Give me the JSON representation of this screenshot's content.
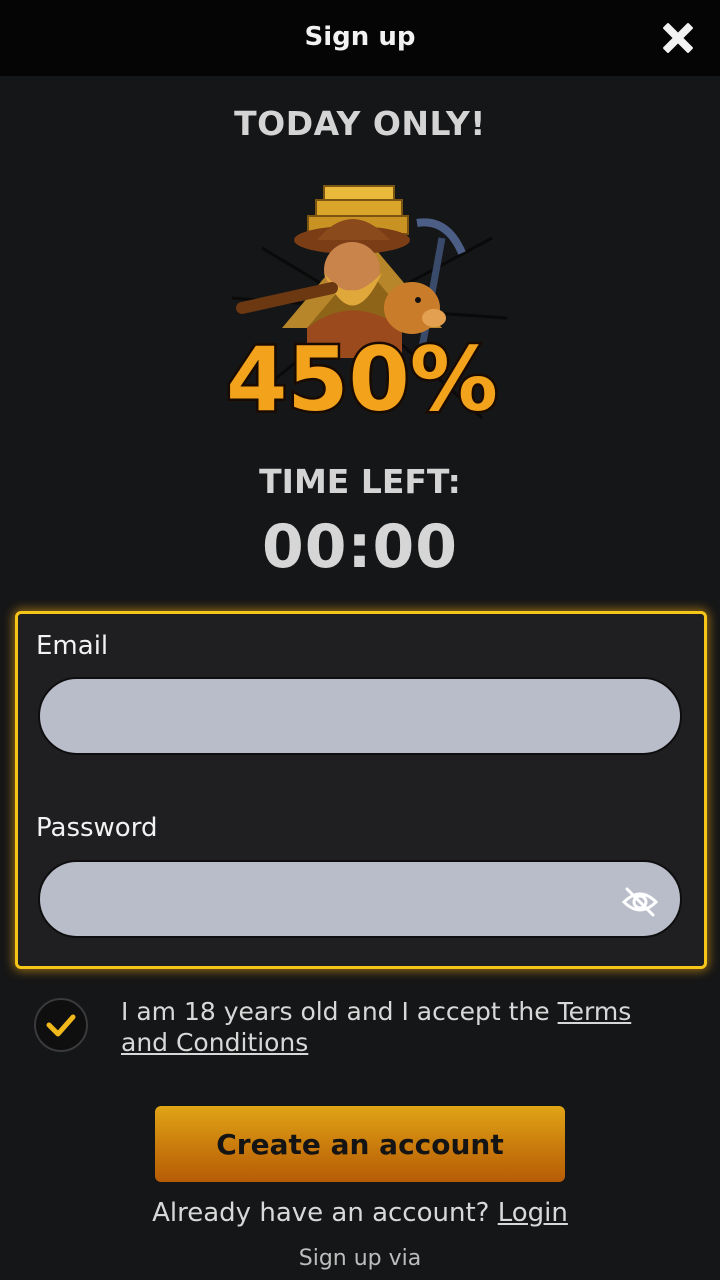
{
  "header": {
    "title": "Sign up",
    "close_icon": "close-icon"
  },
  "promo": {
    "heading": "TODAY ONLY!",
    "bonus_text": "450%",
    "timer_label": "TIME LEFT:",
    "timer_value": "00:00"
  },
  "form": {
    "email_label": "Email",
    "email_value": "",
    "password_label": "Password",
    "password_value": "",
    "password_toggle_icon": "eye-off-icon"
  },
  "consent": {
    "checked": true,
    "text": "I am 18 years old and I accept the ",
    "terms_link": "Terms and Conditions"
  },
  "actions": {
    "create_account_label": "Create an account",
    "already_text": "Already have an account?",
    "login_link": "Login",
    "signup_via": "Sign up via"
  },
  "colors": {
    "accent": "#f5c518",
    "button_top": "#e0a516",
    "button_bottom": "#b65c06",
    "background": "#151617",
    "input": "#b9bdc9"
  }
}
